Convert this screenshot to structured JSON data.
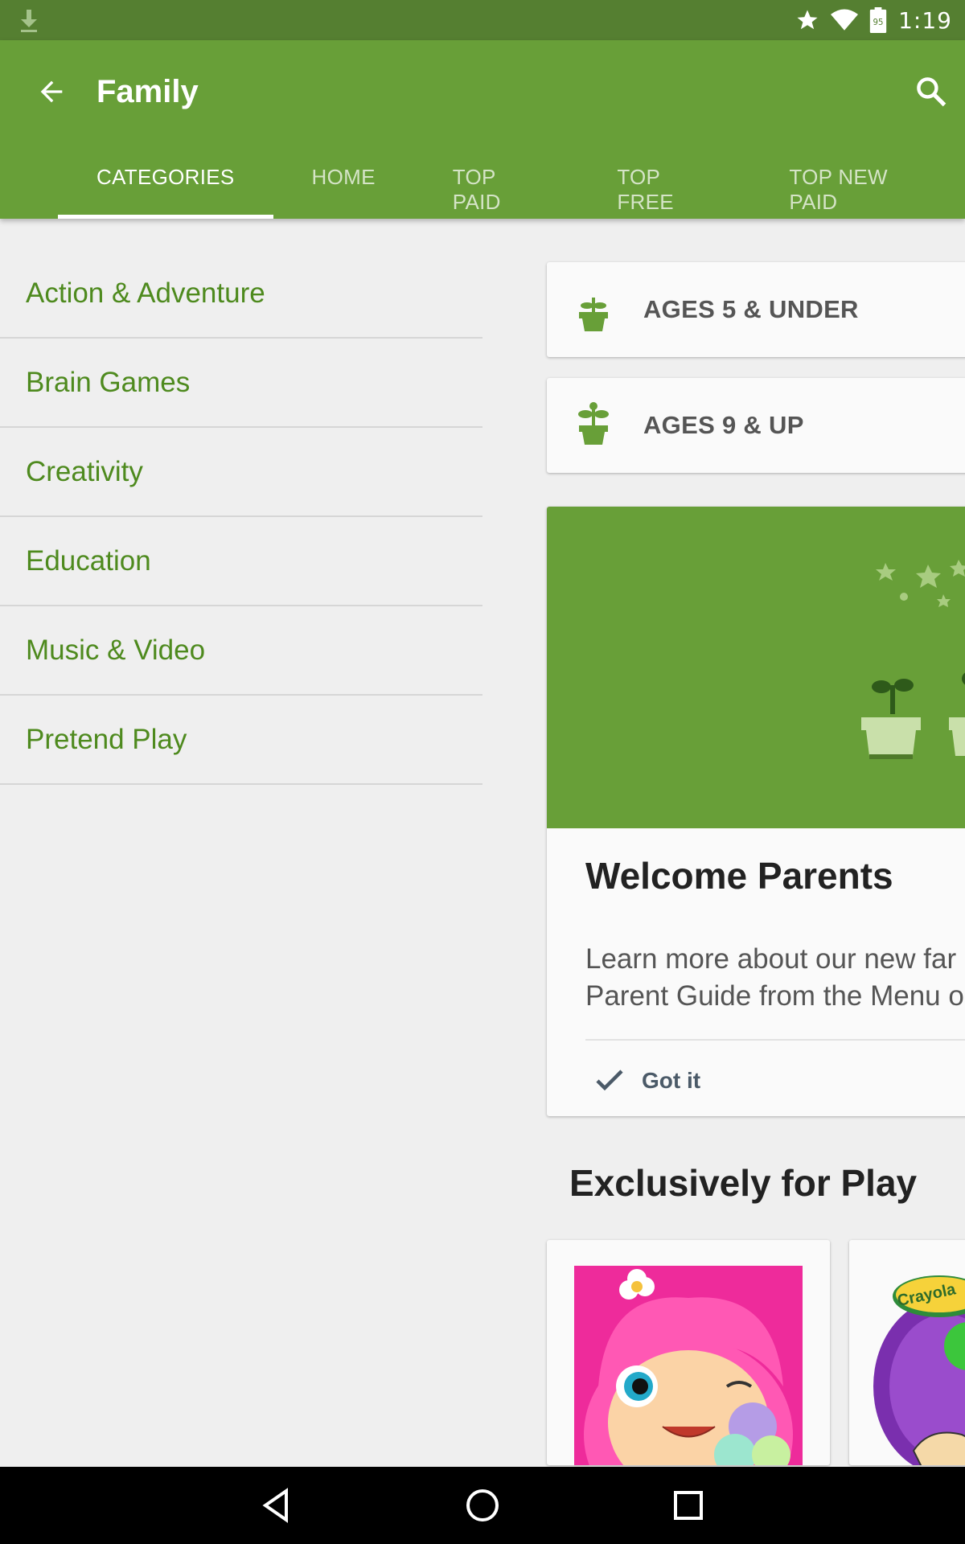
{
  "status_bar": {
    "time": "1:19",
    "battery_level": "95",
    "icons": [
      "download-icon",
      "star-icon",
      "wifi-icon",
      "battery-icon"
    ]
  },
  "app_bar": {
    "title": "Family",
    "tabs": [
      {
        "label": "CATEGORIES",
        "active": true
      },
      {
        "label": "HOME",
        "active": false
      },
      {
        "label": "TOP PAID",
        "active": false
      },
      {
        "label": "TOP FREE",
        "active": false
      },
      {
        "label": "TOP NEW PAID",
        "active": false
      }
    ]
  },
  "categories": [
    "Action & Adventure",
    "Brain Games",
    "Creativity",
    "Education",
    "Music & Video",
    "Pretend Play"
  ],
  "age_cards": [
    {
      "label": "AGES 5 & UNDER",
      "icon": "sprout-small-icon"
    },
    {
      "label": "AGES 9 & UP",
      "icon": "sprout-large-icon"
    }
  ],
  "welcome_card": {
    "title": "Welcome Parents",
    "body_line1": "Learn more about our new far",
    "body_line2": "Parent Guide from the Menu o",
    "action_label": "Got it"
  },
  "section": {
    "title": "Exclusively for Play",
    "apps": [
      {
        "name": "girl-app-thumbnail"
      },
      {
        "name": "crayola-app-thumbnail",
        "logo_text": "Crayola"
      }
    ]
  },
  "colors": {
    "primary": "#689f38",
    "status_bar": "#557f31",
    "category_text": "#4e8a1e",
    "background": "#efefef"
  }
}
